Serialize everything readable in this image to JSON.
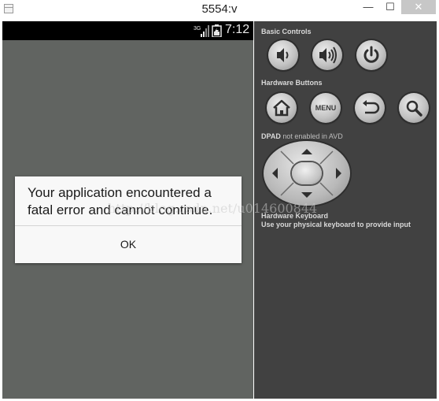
{
  "window": {
    "title": "5554:v",
    "minimize_glyph": "—",
    "maximize_glyph": "☐",
    "close_glyph": "✕",
    "app_icon": "window-app-icon"
  },
  "statusbar": {
    "network": "3G",
    "time": "7:12",
    "icons": [
      "signal-icon",
      "battery-icon"
    ]
  },
  "dialog": {
    "message": "Your application encountered a fatal error and cannot continue.",
    "ok_label": "OK"
  },
  "controls": {
    "basic_title": "Basic Controls",
    "hardware_title": "Hardware Buttons",
    "menu_label": "MENU",
    "dpad_title": "DPAD",
    "dpad_note": "not enabled in AVD",
    "keyboard_title": "Hardware Keyboard",
    "keyboard_hint": "Use your physical keyboard to provide input",
    "basic_buttons": [
      "volume-down-icon",
      "volume-up-icon",
      "power-icon"
    ],
    "hardware_buttons": [
      "home-icon",
      "menu-button",
      "back-icon",
      "search-icon"
    ]
  },
  "watermark": "http://blog.csdn.net/u014600844",
  "colors": {
    "screen_bg": "#616461",
    "panel_bg": "#414141",
    "dialog_bg": "#f8f8f8",
    "statusbar_bg": "#000000"
  }
}
